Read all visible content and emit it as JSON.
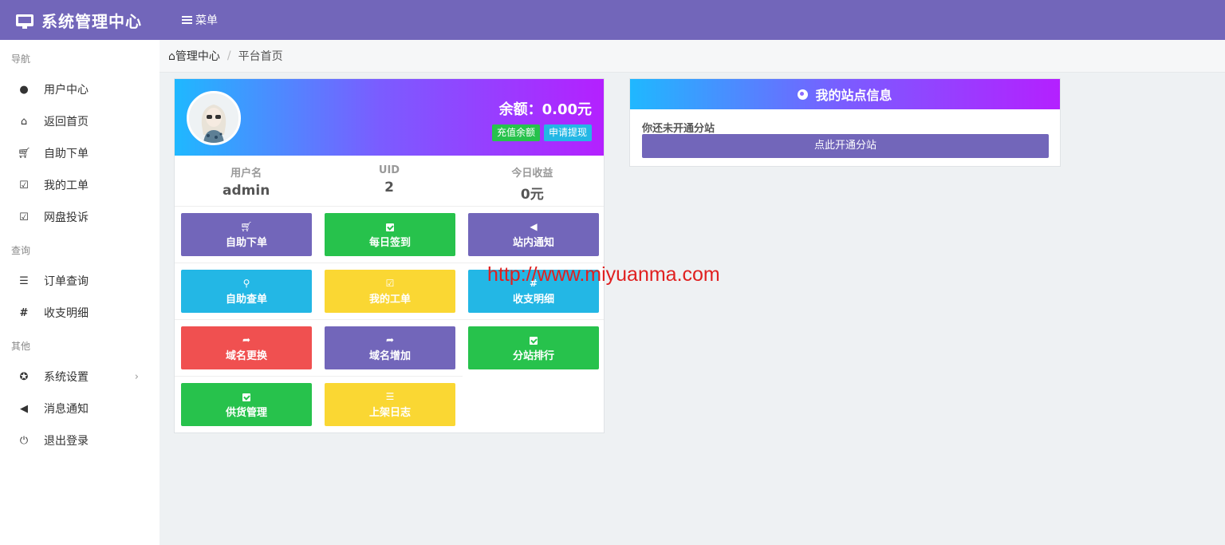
{
  "app": {
    "title": "系统管理中心",
    "menu_label": "菜单"
  },
  "sidebar": {
    "sections": [
      {
        "title": "导航",
        "items": [
          {
            "label": "用户中心",
            "icon": "user-icon"
          },
          {
            "label": "返回首页",
            "icon": "home-icon"
          },
          {
            "label": "自助下单",
            "icon": "cart-icon"
          },
          {
            "label": "我的工单",
            "icon": "check-square-icon"
          },
          {
            "label": "网盘投诉",
            "icon": "check-square-icon"
          }
        ]
      },
      {
        "title": "查询",
        "items": [
          {
            "label": "订单查询",
            "icon": "list-icon"
          },
          {
            "label": "收支明细",
            "icon": "hashtag-icon"
          }
        ]
      },
      {
        "title": "其他",
        "items": [
          {
            "label": "系统设置",
            "icon": "settings-icon",
            "has_submenu": true
          },
          {
            "label": "消息通知",
            "icon": "bullhorn-icon"
          },
          {
            "label": "退出登录",
            "icon": "power-icon"
          }
        ]
      }
    ]
  },
  "breadcrumb": {
    "home": "管理中心",
    "current": "平台首页"
  },
  "user": {
    "balance_label": "余额：",
    "balance_value": "0.00元",
    "recharge_label": "充值余额",
    "withdraw_label": "申请提现",
    "stats": [
      {
        "label": "用户名",
        "value": "admin"
      },
      {
        "label": "UID",
        "value": "2"
      },
      {
        "label": "今日收益",
        "value": "0元"
      }
    ]
  },
  "tiles": [
    {
      "label": "自助下单",
      "icon": "cart-icon",
      "color": "#7266ba"
    },
    {
      "label": "每日签到",
      "icon": "check-square-icon",
      "color": "#27c24c"
    },
    {
      "label": "站内通知",
      "icon": "bullhorn-icon",
      "color": "#7266ba"
    },
    {
      "label": "自助查单",
      "icon": "search-icon",
      "color": "#23b7e5"
    },
    {
      "label": "我的工单",
      "icon": "check-square-icon",
      "color": "#fad733"
    },
    {
      "label": "收支明细",
      "icon": "hashtag-icon",
      "color": "#23b7e5"
    },
    {
      "label": "域名更换",
      "icon": "sign-out-icon",
      "color": "#f05050"
    },
    {
      "label": "域名增加",
      "icon": "sign-out-icon",
      "color": "#7266ba"
    },
    {
      "label": "分站排行",
      "icon": "check-square-icon",
      "color": "#27c24c"
    },
    {
      "label": "供货管理",
      "icon": "check-square-icon",
      "color": "#27c24c"
    },
    {
      "label": "上架日志",
      "icon": "list-icon",
      "color": "#fad733"
    }
  ],
  "site": {
    "title": "我的站点信息",
    "message": "你还未开通分站",
    "button_label": "点此开通分站"
  },
  "watermark": "http://www.miyuanma.com"
}
